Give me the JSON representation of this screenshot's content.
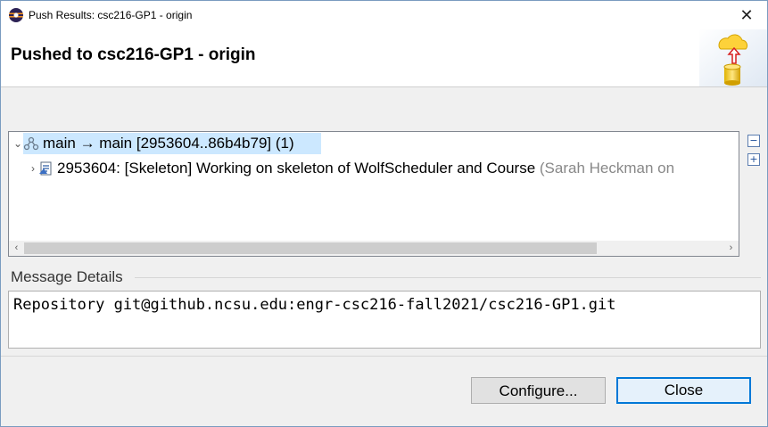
{
  "window": {
    "title": "Push Results: csc216-GP1 - origin",
    "close_glyph": "✕"
  },
  "banner": {
    "heading": "Pushed to csc216-GP1 - origin",
    "image_icon": "cloud-push-database-icon"
  },
  "results": {
    "rows": [
      {
        "text": "main → main [2953604..86b4b79] (1)",
        "icon": "branch-ref-icon",
        "expanded": true,
        "selected": true
      },
      {
        "text": "2953604: [Skeleton] Working on skeleton of WolfScheduler and Course ",
        "author": "(Sarah Heckman on",
        "icon": "commit-icon",
        "expanded": false,
        "selected": false
      }
    ],
    "collapse_all_icon": "collapse-all-icon",
    "expand_all_icon": "expand-all-icon"
  },
  "message_details": {
    "label": "Message Details",
    "text": "Repository git@github.ncsu.edu:engr-csc216-fall2021/csc216-GP1.git"
  },
  "buttons": {
    "configure": "Configure...",
    "close": "Close"
  },
  "colors": {
    "selection": "#cce8ff",
    "default_button_border": "#0078d7"
  }
}
